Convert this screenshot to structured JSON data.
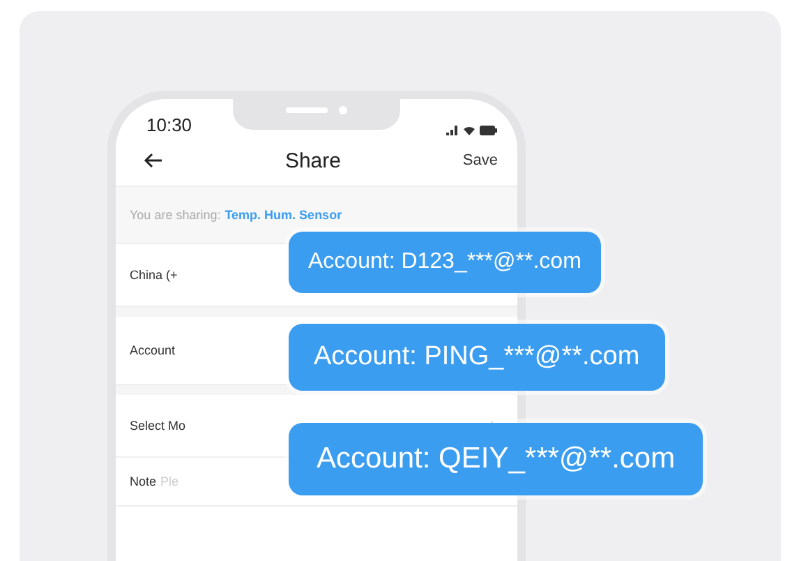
{
  "status_bar": {
    "time": "10:30"
  },
  "nav": {
    "title": "Share",
    "action": "Save"
  },
  "sharing": {
    "label": "You are sharing:",
    "device": "Temp. Hum. Sensor"
  },
  "rows": [
    {
      "kind": "field",
      "label": "China (+"
    },
    {
      "kind": "field",
      "label": "Account"
    },
    {
      "kind": "link",
      "label": "Select Mo"
    },
    {
      "kind": "note",
      "label": "Note",
      "placeholder": "Ple"
    }
  ],
  "bubbles": [
    {
      "text": "Account: D123_***@**.com"
    },
    {
      "text": "Account: PING_***@**.com"
    },
    {
      "text": "Account: QEIY_***@**.com"
    }
  ]
}
